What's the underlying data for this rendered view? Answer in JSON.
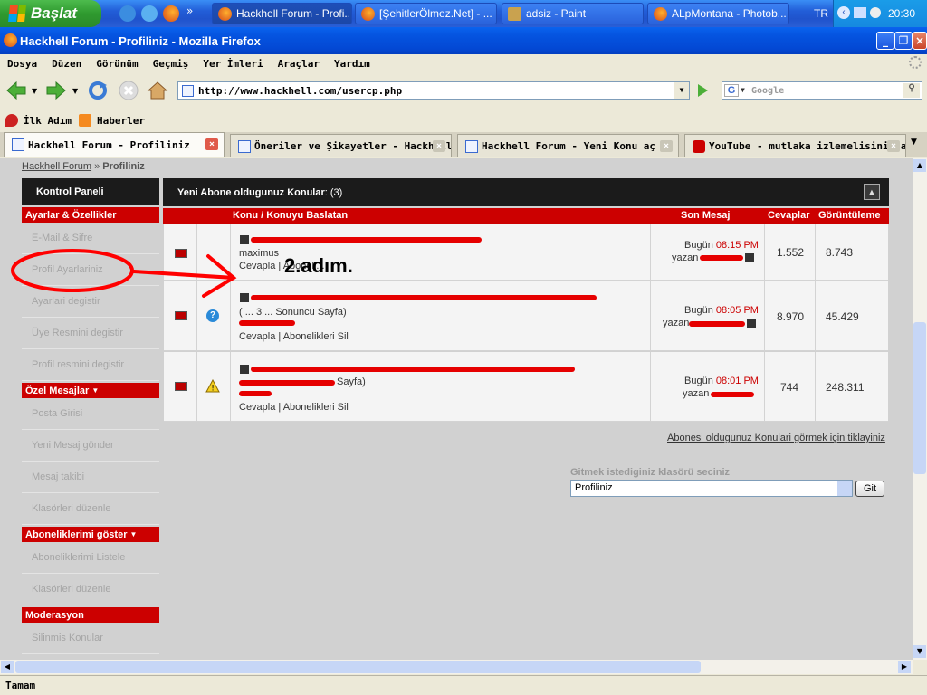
{
  "taskbar": {
    "start_label": "Başlat",
    "tasks": [
      "Hackhell Forum - Profi...",
      "[ŞehitlerÖlmez.Net] - ...",
      "adsiz - Paint",
      "ALpMontana - Photob..."
    ],
    "tray_lang": "TR",
    "tray_time": "20:30"
  },
  "window": {
    "title": "Hackhell Forum - Profiliniz - Mozilla Firefox"
  },
  "menu": [
    "Dosya",
    "Düzen",
    "Görünüm",
    "Geçmiş",
    "Yer İmleri",
    "Araçlar",
    "Yardım"
  ],
  "nav": {
    "url": "http://www.hackhell.com/usercp.php",
    "search_placeholder": "Google"
  },
  "bookmarks": [
    "İlk Adım",
    "Haberler"
  ],
  "tabs": [
    "Hackhell Forum - Profiliniz",
    "Öneriler ve Şikayetler - Hackhell ...",
    "Hackhell Forum - Yeni Konu aç",
    "YouTube - mutlaka izlemelisiniz all..."
  ],
  "breadcrumb": {
    "root": "Hackhell Forum",
    "sep": "»",
    "current": "Profiliniz"
  },
  "sidebar": {
    "header": "Kontrol Paneli",
    "sections": [
      {
        "title": "Ayarlar & Özellikler",
        "items": [
          "E-Mail & Sifre",
          "Profil Ayarlariniz",
          "Ayarlari degistir",
          "Üye Resmini degistir",
          "Profil resmini degistir"
        ]
      },
      {
        "title": "Özel Mesajlar",
        "items": [
          "Posta Girisi",
          "Yeni Mesaj gönder",
          "Mesaj takibi",
          "Klasörleri düzenle"
        ]
      },
      {
        "title": "Aboneliklerimi göster",
        "items": [
          "Aboneliklerimi Listele",
          "Klasörleri düzenle"
        ]
      },
      {
        "title": "Moderasyon",
        "items": [
          "Silinmis Konular"
        ]
      }
    ]
  },
  "main": {
    "heading": "Yeni Abone oldugunuz Konular",
    "count": ": (3)",
    "columns": [
      "Konu / Konuyu Baslatan",
      "Son Mesaj",
      "Cevaplar",
      "Görüntüleme"
    ],
    "rows": [
      {
        "starter": "maximus",
        "actions": "Cevapla | Aboneli...",
        "last_day": "Bugün",
        "last_time": "08:15 PM",
        "by": "yazan",
        "replies": "1.552",
        "views": "8.743",
        "icon": "none"
      },
      {
        "starter": "( ... 3 ... Sonuncu Sayfa)",
        "actions": "Cevapla | Abonelikleri Sil",
        "last_day": "Bugün",
        "last_time": "08:05 PM",
        "by": "yazan",
        "replies": "8.970",
        "views": "45.429",
        "icon": "question"
      },
      {
        "starter": "Sayfa)",
        "actions": "Cevapla | Abonelikleri Sil",
        "last_day": "Bugün",
        "last_time": "08:01 PM",
        "by": "yazan",
        "replies": "744",
        "views": "248.311",
        "icon": "warning"
      }
    ],
    "subs_link": "Abonesi oldugunuz Konulari görmek için tiklayiniz",
    "goto_label": "Gitmek istediginiz klasörü seciniz",
    "goto_selected": "Profiliniz",
    "goto_button": "Git"
  },
  "annotation": "2.adım.",
  "status": "Tamam"
}
